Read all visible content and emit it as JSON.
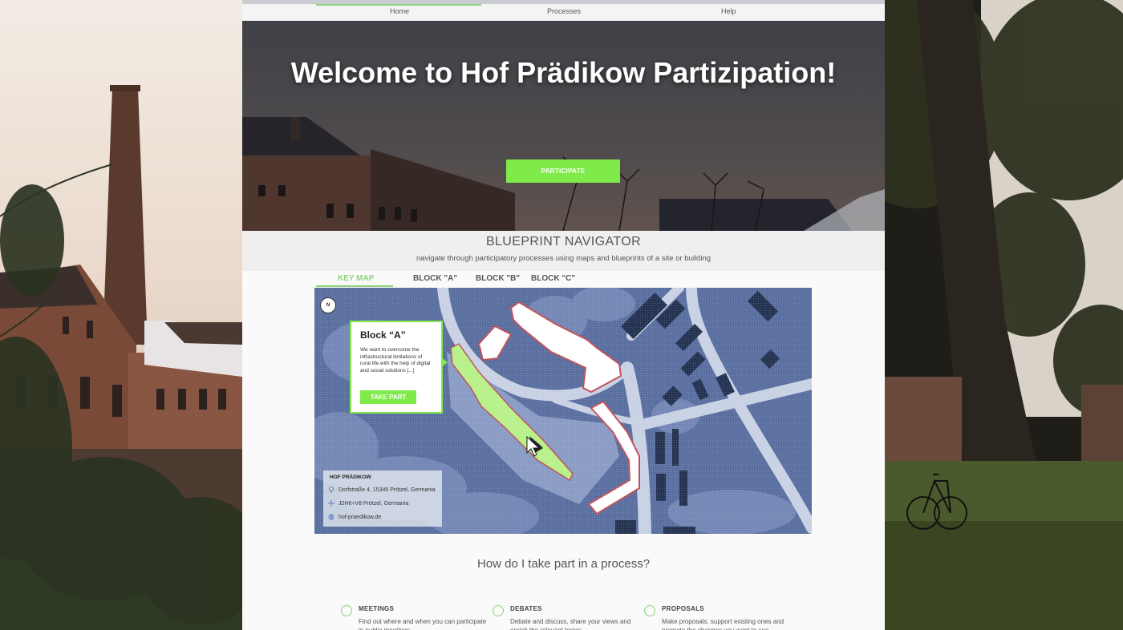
{
  "nav": {
    "items": [
      "Home",
      "Processes",
      "Help"
    ]
  },
  "hero": {
    "title": "Welcome to Hof Prädikow Partizipation!",
    "button": "PARTICIPATE"
  },
  "blueprint": {
    "title": "BLUEPRINT NAVIGATOR",
    "subtitle": "navigate through participatory processes using maps and blueprints of a site or building",
    "tabs": [
      "KEY MAP",
      "BLOCK \"A\"",
      "BLOCK \"B\"",
      "BLOCK \"C\""
    ],
    "active_tab": "KEY MAP",
    "compass": "N",
    "callout": {
      "title": "Block “A”",
      "text": "We want to overcome the infrastructural limitations of rural life with the help of digital and social solutions [...]",
      "button": "TAKE PART"
    },
    "info": {
      "title": "HOF PRÄDIKOW",
      "address": "Dorfstraße 4, 15345 Prötzel, Germania",
      "plus_code": "J2H6+V8 Prötzel, Germania",
      "website": "hof-praedikow.de"
    }
  },
  "how": {
    "title": "How do I take part in a process?"
  },
  "features": [
    {
      "title": "MEETINGS",
      "desc": "Find out where and when you can participate in public meetings."
    },
    {
      "title": "DEBATES",
      "desc": "Debate and discuss, share your views and enrich the relevant topics."
    },
    {
      "title": "PROPOSALS",
      "desc": "Make proposals, support existing ones and promote the changes you want to see."
    }
  ],
  "colors": {
    "accent": "#7fea4a",
    "map_bg": "#5a6fa0",
    "highlight_block": "#b8f08a",
    "outline": "#c0505a"
  }
}
